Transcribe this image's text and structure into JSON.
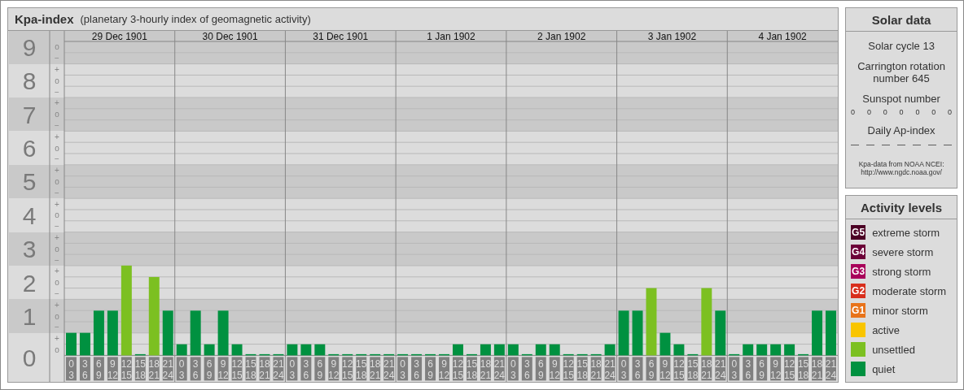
{
  "main": {
    "title": "Kpa-index",
    "subtitle": "(planetary 3-hourly index of geomagnetic activity)",
    "days": [
      {
        "date": "29 Dec 1901",
        "hours": [
          {
            "from": "0",
            "to": "3"
          },
          {
            "from": "3",
            "to": "6"
          },
          {
            "from": "6",
            "to": "9"
          },
          {
            "from": "9",
            "to": "12"
          },
          {
            "from": "12",
            "to": "15"
          },
          {
            "from": "15",
            "to": "18"
          },
          {
            "from": "18",
            "to": "21"
          },
          {
            "from": "21",
            "to": "24"
          }
        ]
      },
      {
        "date": "30 Dec 1901",
        "hours": [
          {
            "from": "0",
            "to": "3"
          },
          {
            "from": "3",
            "to": "6"
          },
          {
            "from": "6",
            "to": "9"
          },
          {
            "from": "9",
            "to": "12"
          },
          {
            "from": "12",
            "to": "15"
          },
          {
            "from": "15",
            "to": "18"
          },
          {
            "from": "18",
            "to": "21"
          },
          {
            "from": "21",
            "to": "24"
          }
        ]
      },
      {
        "date": "31 Dec 1901",
        "hours": [
          {
            "from": "0",
            "to": "3"
          },
          {
            "from": "3",
            "to": "6"
          },
          {
            "from": "6",
            "to": "9"
          },
          {
            "from": "9",
            "to": "12"
          },
          {
            "from": "12",
            "to": "15"
          },
          {
            "from": "15",
            "to": "18"
          },
          {
            "from": "18",
            "to": "21"
          },
          {
            "from": "21",
            "to": "24"
          }
        ]
      },
      {
        "date": "1 Jan 1902",
        "hours": [
          {
            "from": "0",
            "to": "3"
          },
          {
            "from": "3",
            "to": "6"
          },
          {
            "from": "6",
            "to": "9"
          },
          {
            "from": "9",
            "to": "12"
          },
          {
            "from": "12",
            "to": "15"
          },
          {
            "from": "15",
            "to": "18"
          },
          {
            "from": "18",
            "to": "21"
          },
          {
            "from": "21",
            "to": "24"
          }
        ]
      },
      {
        "date": "2 Jan 1902",
        "hours": [
          {
            "from": "0",
            "to": "3"
          },
          {
            "from": "3",
            "to": "6"
          },
          {
            "from": "6",
            "to": "9"
          },
          {
            "from": "9",
            "to": "12"
          },
          {
            "from": "12",
            "to": "15"
          },
          {
            "from": "15",
            "to": "18"
          },
          {
            "from": "18",
            "to": "21"
          },
          {
            "from": "21",
            "to": "24"
          }
        ]
      },
      {
        "date": "3 Jan 1902",
        "hours": [
          {
            "from": "0",
            "to": "3"
          },
          {
            "from": "3",
            "to": "6"
          },
          {
            "from": "6",
            "to": "9"
          },
          {
            "from": "9",
            "to": "12"
          },
          {
            "from": "12",
            "to": "15"
          },
          {
            "from": "15",
            "to": "18"
          },
          {
            "from": "18",
            "to": "21"
          },
          {
            "from": "21",
            "to": "24"
          }
        ]
      },
      {
        "date": "4 Jan 1902",
        "hours": [
          {
            "from": "0",
            "to": "3"
          },
          {
            "from": "3",
            "to": "6"
          },
          {
            "from": "6",
            "to": "9"
          },
          {
            "from": "9",
            "to": "12"
          },
          {
            "from": "12",
            "to": "15"
          },
          {
            "from": "15",
            "to": "18"
          },
          {
            "from": "18",
            "to": "21"
          },
          {
            "from": "21",
            "to": "24"
          }
        ]
      }
    ],
    "minor_ticks": [
      "o",
      "−",
      "+",
      "o",
      "−",
      "+",
      "o",
      "−",
      "+",
      "o",
      "−",
      "+",
      "o",
      "−",
      "+",
      "o",
      "−",
      "+",
      "o",
      "−",
      "+",
      "o",
      "−",
      "+",
      "o",
      "−",
      "+",
      "o"
    ],
    "chart_data": {
      "type": "bar",
      "ylim": [
        0,
        9
      ],
      "grid": true,
      "yticks": [
        {
          "value": 9,
          "label": "9"
        },
        {
          "value": 8,
          "label": "8"
        },
        {
          "value": 7,
          "label": "7"
        },
        {
          "value": 6,
          "label": "6"
        },
        {
          "value": 5,
          "label": "5"
        },
        {
          "value": 4,
          "label": "4"
        },
        {
          "value": 3,
          "label": "3"
        },
        {
          "value": 2,
          "label": "2"
        },
        {
          "value": 1,
          "label": "1"
        },
        {
          "value": 0,
          "label": "0"
        }
      ],
      "values": [
        0.67,
        0.67,
        1.33,
        1.33,
        2.67,
        0,
        2.33,
        1.33,
        0.33,
        1.33,
        0.33,
        1.33,
        0.33,
        0,
        0,
        0,
        0.33,
        0.33,
        0.33,
        0,
        0,
        0,
        0,
        0,
        0,
        0,
        0,
        0,
        0.33,
        0,
        0.33,
        0.33,
        0.33,
        0,
        0.33,
        0.33,
        0,
        0,
        0,
        0.33,
        1.33,
        1.33,
        2,
        0.67,
        0.33,
        0,
        2,
        1.33,
        0,
        0.33,
        0.33,
        0.33,
        0.33,
        0,
        1.33,
        1.33
      ]
    }
  },
  "solar": {
    "title": "Solar data",
    "cycle": "Solar cycle 13",
    "rotation": "Carrington rotation number 645",
    "sunspot_label": "Sunspot number",
    "sunspots": [
      "0",
      "0",
      "0",
      "0",
      "0",
      "0",
      "0"
    ],
    "ap_label": "Daily Ap-index",
    "ap": [
      "—",
      "—",
      "—",
      "—",
      "—",
      "—",
      "—"
    ],
    "source": "Kpa-data from NOAA NCEI:",
    "source_url": "http://www.ngdc.noaa.gov/"
  },
  "legend": {
    "title": "Activity levels",
    "items": [
      {
        "badge": "G5",
        "label": "extreme storm",
        "color": "#4c0025"
      },
      {
        "badge": "G4",
        "label": "severe storm",
        "color": "#6c0038"
      },
      {
        "badge": "G3",
        "label": "strong storm",
        "color": "#a8005a"
      },
      {
        "badge": "G2",
        "label": "moderate storm",
        "color": "#d82e1c"
      },
      {
        "badge": "G1",
        "label": "minor storm",
        "color": "#e8731a"
      },
      {
        "label": "active",
        "color": "#f9c500"
      },
      {
        "label": "unsettled",
        "color": "#7cc021"
      },
      {
        "label": "quiet",
        "color": "#009140"
      }
    ]
  }
}
